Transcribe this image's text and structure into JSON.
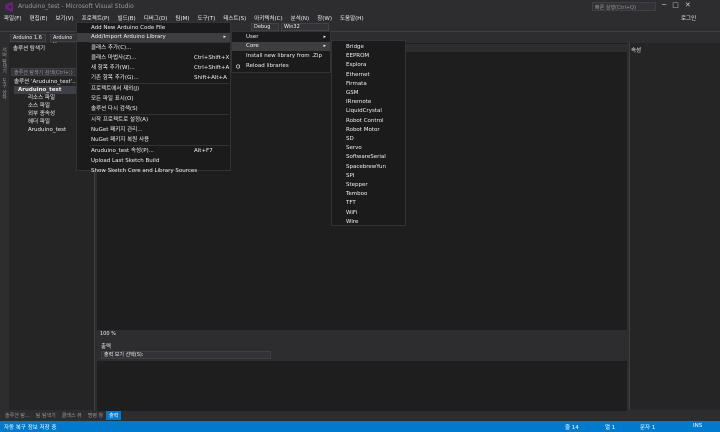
{
  "window": {
    "title": "Aruduino_test - Microsoft Visual Studio",
    "quick_launch": "빠른 실행(Ctrl+Q)",
    "login": "로그인"
  },
  "menubar": [
    "파일(F)",
    "편집(E)",
    "보기(V)",
    "프로젝트(P)",
    "빌드(B)",
    "디버그(D)",
    "팀(M)",
    "도구(T)",
    "테스트(S)",
    "아키텍처(C)",
    "분석(N)",
    "창(W)",
    "도움말(H)"
  ],
  "toolbar": {
    "config": "Debug",
    "platform": "Win32",
    "arduino_version": "Arduino 1.6",
    "board": "Arduino Uno"
  },
  "solution_explorer": {
    "title": "솔루션 탐색기",
    "search_placeholder": "솔루션 탐색기 검색(Ctrl+;)",
    "items": [
      "솔루션 'Aruduino_test'...",
      "Aruduino_test",
      "리소스 파일",
      "소스 파일",
      "외부 종속성",
      "헤더 파일",
      "Aruduino_test"
    ]
  },
  "side_tabs": [
    "서버 탐색기",
    "도구 상자"
  ],
  "context_menu": {
    "items": [
      {
        "label": "Add New Arduino Code File",
        "shortcut": ""
      },
      {
        "label": "Add/Import Arduino Library",
        "shortcut": ""
      },
      {
        "label": "클래스 추가(C)...",
        "shortcut": ""
      },
      {
        "label": "클래스 마법사(Z)...",
        "shortcut": "Ctrl+Shift+X"
      },
      {
        "label": "새 항목 추가(W)...",
        "shortcut": "Ctrl+Shift+A"
      },
      {
        "label": "기존 항목 추가(G)...",
        "shortcut": "Shift+Alt+A"
      },
      {
        "label": "프로젝트에서 제외(J)",
        "shortcut": ""
      },
      {
        "label": "모든 파일 표시(O)",
        "shortcut": ""
      },
      {
        "label": "솔루션 다시 검색(S)",
        "shortcut": ""
      },
      {
        "label": "시작 프로젝트로 설정(A)",
        "shortcut": ""
      },
      {
        "label": "NuGet 패키지 관리...",
        "shortcut": ""
      },
      {
        "label": "NuGet 패키지 복원 사용",
        "shortcut": ""
      },
      {
        "label": "Aruduino_test 속성(P)...",
        "shortcut": "Alt+F7"
      },
      {
        "label": "Upload Last Sketch Build",
        "shortcut": ""
      },
      {
        "label": "Show Sketch Core and Library Sources",
        "shortcut": ""
      }
    ]
  },
  "submenu": {
    "items": [
      "User",
      "Core",
      "Install new library from .Zip",
      "Reload libraries"
    ]
  },
  "core_libraries": [
    "Bridge",
    "EEPROM",
    "Esplora",
    "Ethernet",
    "Firmata",
    "GSM",
    "IRremote",
    "LiquidCrystal",
    "Robot Control",
    "Robot Motor",
    "SD",
    "Servo",
    "SoftwareSerial",
    "SpacebrewYun",
    "SPI",
    "Stepper",
    "Temboo",
    "TFT",
    "WiFi",
    "Wire"
  ],
  "editor": {
    "zoom": "100 %"
  },
  "output": {
    "title": "출력",
    "show_from_label": "출력 보기 선택(S):"
  },
  "properties": {
    "title": "속성"
  },
  "bottom_tabs": [
    "솔루션 탐...",
    "팀 탐색기",
    "클래스 뷰",
    "명령 창",
    "출력"
  ],
  "status": {
    "message": "자동 복구 정보 저장 중",
    "line": "줄 14",
    "col": "열 1",
    "char": "문자 1",
    "mode": "INS"
  },
  "colors": {
    "accent": "#007acc",
    "background": "#2d2d30",
    "menu": "#1b1b1c"
  }
}
